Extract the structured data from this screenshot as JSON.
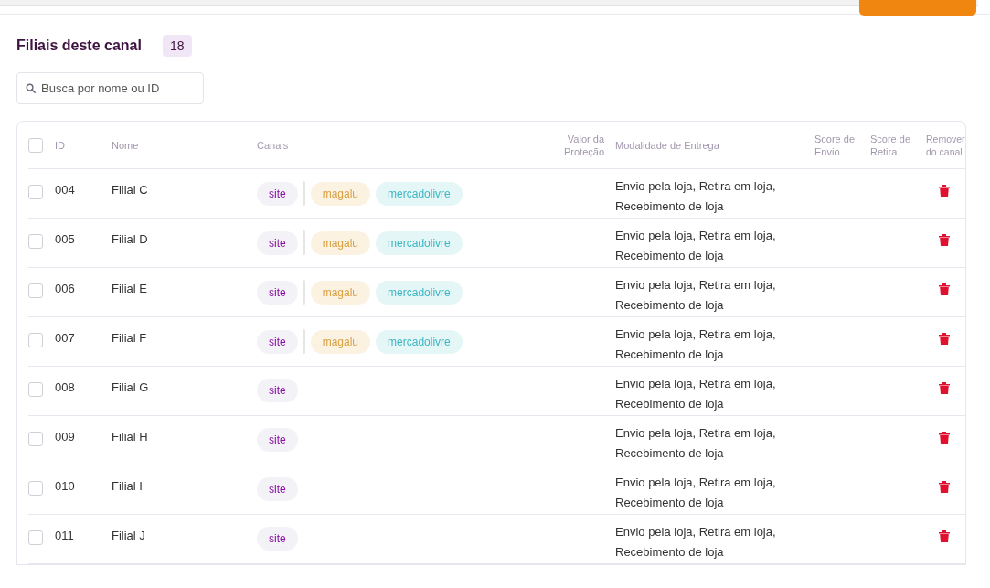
{
  "section": {
    "title": "Filiais deste canal",
    "count": "18"
  },
  "search": {
    "placeholder": "Busca por nome ou ID"
  },
  "table": {
    "select_all": {
      "checked": false
    },
    "columns": [
      "ID",
      "Nome",
      "Canais",
      "Valor da Proteção",
      "Modalidade de Entrega",
      "Score de Envio",
      "Score de Retira",
      "Remover do canal"
    ],
    "rows": [
      {
        "checked": false,
        "id": "004",
        "name": "Filial C",
        "channels": [
          {
            "label": "site",
            "kind": "site"
          },
          {
            "label": "magalu",
            "kind": "magalu"
          },
          {
            "label": "mercadolivre",
            "kind": "mercadolivre"
          }
        ],
        "delivery": "Envio pela loja, Retira em loja, Recebimento de loja"
      },
      {
        "checked": false,
        "id": "005",
        "name": "Filial D",
        "channels": [
          {
            "label": "site",
            "kind": "site"
          },
          {
            "label": "magalu",
            "kind": "magalu"
          },
          {
            "label": "mercadolivre",
            "kind": "mercadolivre"
          }
        ],
        "delivery": "Envio pela loja, Retira em loja, Recebimento de loja"
      },
      {
        "checked": false,
        "id": "006",
        "name": "Filial E",
        "channels": [
          {
            "label": "site",
            "kind": "site"
          },
          {
            "label": "magalu",
            "kind": "magalu"
          },
          {
            "label": "mercadolivre",
            "kind": "mercadolivre"
          }
        ],
        "delivery": "Envio pela loja, Retira em loja, Recebimento de loja"
      },
      {
        "checked": false,
        "id": "007",
        "name": "Filial F",
        "channels": [
          {
            "label": "site",
            "kind": "site"
          },
          {
            "label": "magalu",
            "kind": "magalu"
          },
          {
            "label": "mercadolivre",
            "kind": "mercadolivre"
          }
        ],
        "delivery": "Envio pela loja, Retira em loja, Recebimento de loja"
      },
      {
        "checked": false,
        "id": "008",
        "name": "Filial G",
        "channels": [
          {
            "label": "site",
            "kind": "site"
          }
        ],
        "delivery": "Envio pela loja, Retira em loja, Recebimento de loja"
      },
      {
        "checked": false,
        "id": "009",
        "name": "Filial H",
        "channels": [
          {
            "label": "site",
            "kind": "site"
          }
        ],
        "delivery": "Envio pela loja, Retira em loja, Recebimento de loja"
      },
      {
        "checked": false,
        "id": "010",
        "name": "Filial I",
        "channels": [
          {
            "label": "site",
            "kind": "site"
          }
        ],
        "delivery": "Envio pela loja, Retira em loja, Recebimento de loja"
      },
      {
        "checked": false,
        "id": "011",
        "name": "Filial J",
        "channels": [
          {
            "label": "site",
            "kind": "site"
          }
        ],
        "delivery": "Envio pela loja, Retira em loja, Recebimento de loja"
      }
    ]
  }
}
